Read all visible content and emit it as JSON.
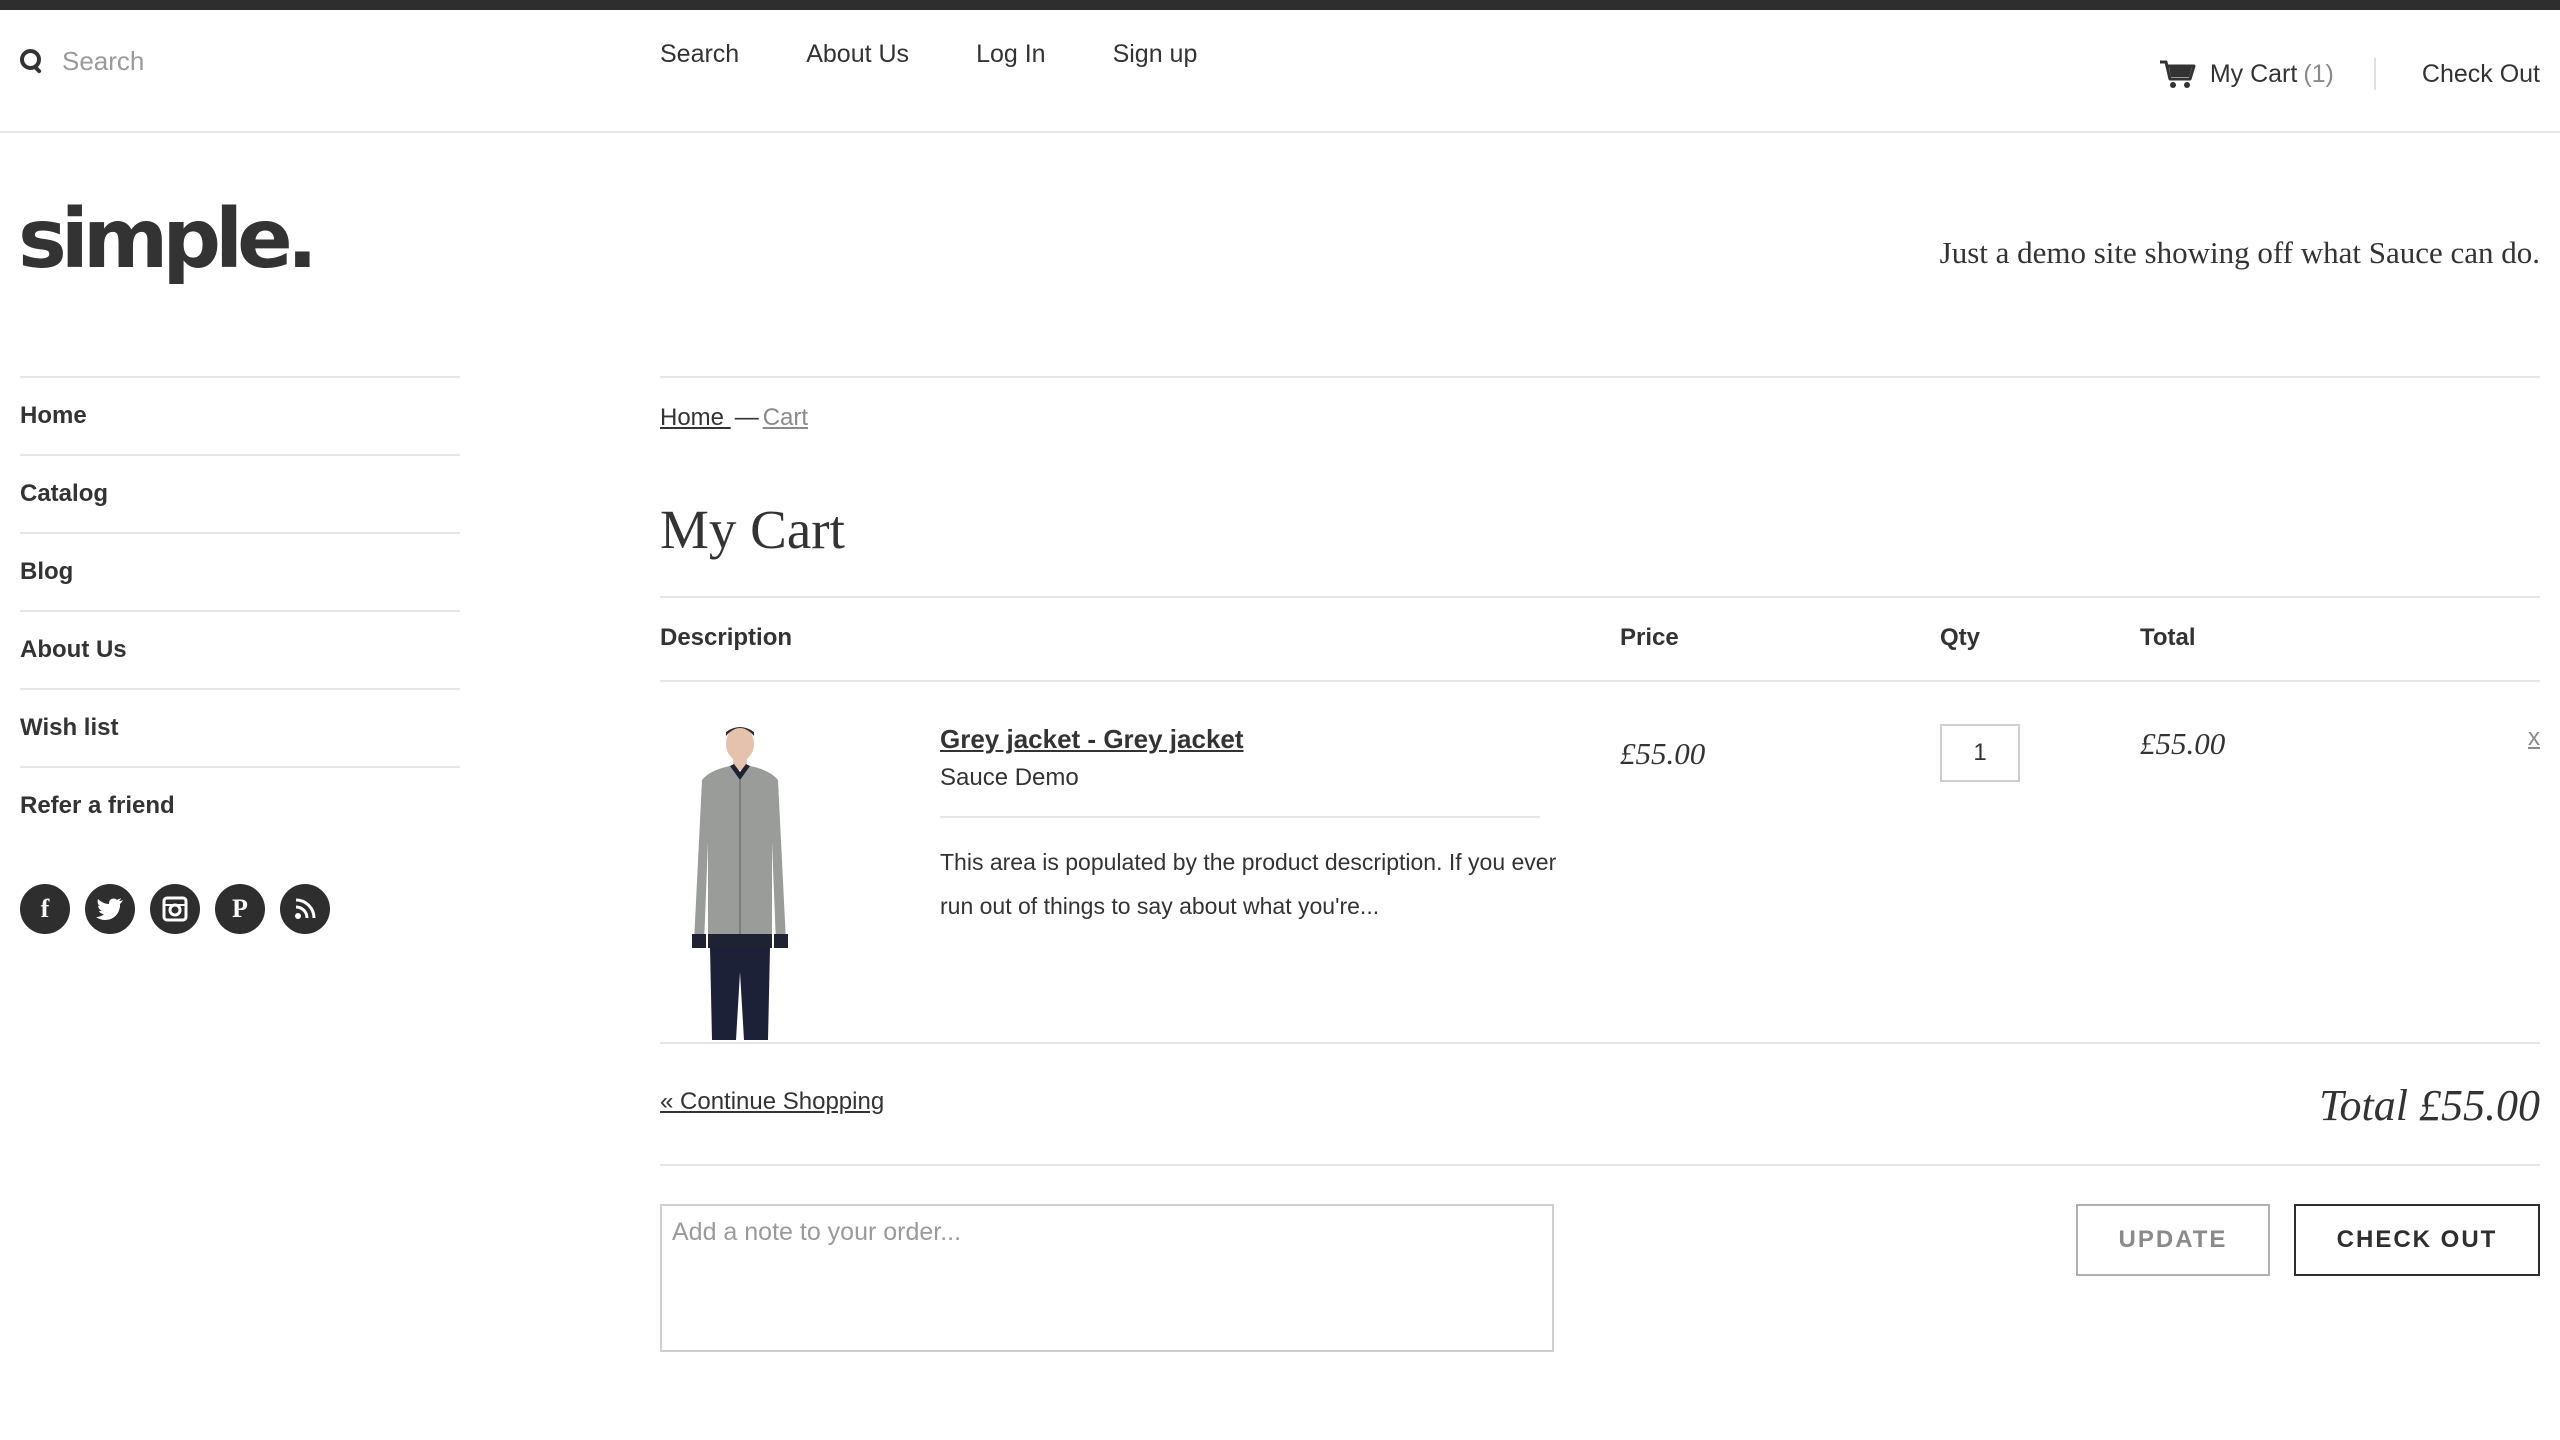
{
  "header": {
    "search_placeholder": "Search",
    "nav": [
      "Search",
      "About Us",
      "Log In",
      "Sign up"
    ],
    "cart_label": "My Cart",
    "cart_count": "(1)",
    "checkout_label": "Check Out"
  },
  "brand": {
    "logo_text": "simple.",
    "tagline": "Just a demo site showing off what Sauce can do."
  },
  "sidebar": {
    "items": [
      "Home",
      "Catalog",
      "Blog",
      "About Us",
      "Wish list",
      "Refer a friend"
    ],
    "social_icons": [
      "facebook-icon",
      "twitter-icon",
      "instagram-icon",
      "pinterest-icon",
      "rss-icon"
    ]
  },
  "breadcrumb": {
    "home": "Home ",
    "separator": "—",
    "current": "Cart"
  },
  "page_title": "My Cart",
  "table": {
    "headers": {
      "description": "Description",
      "price": "Price",
      "qty": "Qty",
      "total": "Total"
    },
    "items": [
      {
        "name": "Grey jacket - Grey jacket",
        "vendor": "Sauce Demo",
        "description": "This area is populated by the product description. If you ever run out of things to say about what you're...",
        "price": "£55.00",
        "qty": "1",
        "total": "£55.00",
        "remove": "x"
      }
    ]
  },
  "footer": {
    "continue_shopping": "« Continue Shopping",
    "grand_total": "Total £55.00",
    "note_placeholder": "Add a note to your order...",
    "update_button": "UPDATE",
    "checkout_button": "CHECK OUT"
  },
  "colors": {
    "text": "#333333",
    "muted": "#8a8a8a",
    "border": "#e6e6e6",
    "dark": "#2e2e2e"
  }
}
